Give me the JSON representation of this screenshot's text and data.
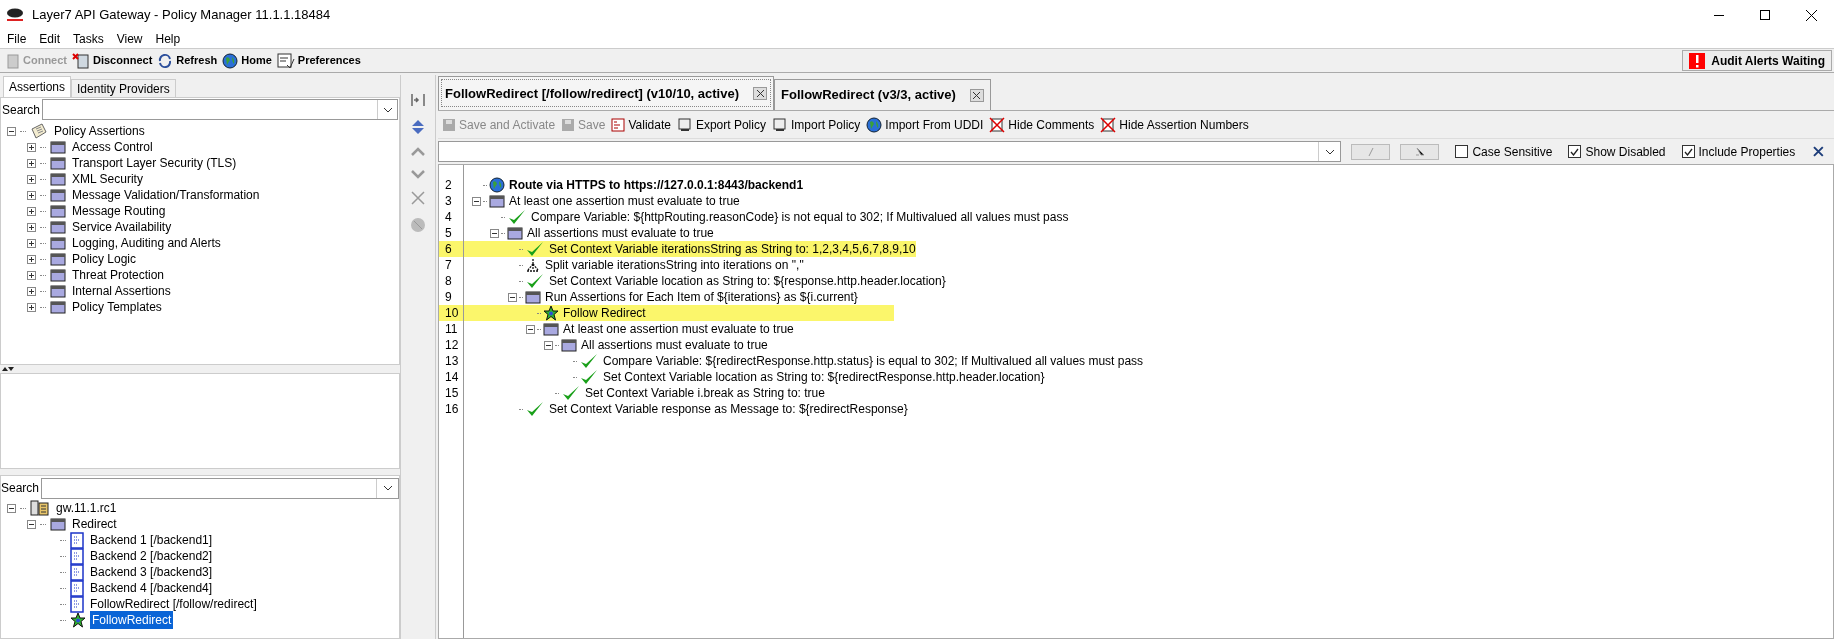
{
  "window": {
    "title": "Layer7 API Gateway - Policy Manager 11.1.1.18484"
  },
  "menu": [
    "File",
    "Edit",
    "Tasks",
    "View",
    "Help"
  ],
  "toolbar": [
    {
      "label": "Connect",
      "kind": "connect",
      "disabled": true
    },
    {
      "label": "Disconnect",
      "kind": "disconnect",
      "disabled": false
    },
    {
      "label": "Refresh",
      "kind": "refresh",
      "disabled": false
    },
    {
      "label": "Home",
      "kind": "home",
      "disabled": false
    },
    {
      "label": "Preferences",
      "kind": "preferences",
      "disabled": false
    }
  ],
  "audit_alert": "Audit Alerts Waiting",
  "left_tabs": [
    {
      "label": "Assertions",
      "selected": true
    },
    {
      "label": "Identity Providers",
      "selected": false
    }
  ],
  "assertions_search": {
    "label": "Search"
  },
  "assertions_tree": [
    {
      "label": "Policy Assertions",
      "kind": "root",
      "expanded": true,
      "children": [
        {
          "label": "Access Control",
          "kind": "folder",
          "expanded": false
        },
        {
          "label": "Transport Layer Security (TLS)",
          "kind": "folder",
          "expanded": false
        },
        {
          "label": "XML Security",
          "kind": "folder",
          "expanded": false
        },
        {
          "label": "Message Validation/Transformation",
          "kind": "folder",
          "expanded": false
        },
        {
          "label": "Message Routing",
          "kind": "folder",
          "expanded": false
        },
        {
          "label": "Service Availability",
          "kind": "folder",
          "expanded": false
        },
        {
          "label": "Logging, Auditing and Alerts",
          "kind": "folder",
          "expanded": false
        },
        {
          "label": "Policy Logic",
          "kind": "folder",
          "expanded": false
        },
        {
          "label": "Threat Protection",
          "kind": "folder",
          "expanded": false
        },
        {
          "label": "Internal Assertions",
          "kind": "folder",
          "expanded": false
        },
        {
          "label": "Policy Templates",
          "kind": "folder",
          "expanded": false
        }
      ]
    }
  ],
  "services_search": {
    "label": "Search"
  },
  "services_tree": [
    {
      "label": "gw.11.1.rc1",
      "kind": "gateway",
      "expanded": true,
      "selected": false,
      "children": [
        {
          "label": "Redirect",
          "kind": "folder",
          "expanded": true,
          "selected": false,
          "children": [
            {
              "label": "Backend 1 [/backend1]",
              "kind": "service",
              "selected": false
            },
            {
              "label": "Backend 2 [/backend2]",
              "kind": "service",
              "selected": false
            },
            {
              "label": "Backend 3 [/backend3]",
              "kind": "service",
              "selected": false
            },
            {
              "label": "Backend 4 [/backend4]",
              "kind": "service",
              "selected": false
            },
            {
              "label": "FollowRedirect [/follow/redirect]",
              "kind": "service",
              "selected": false
            },
            {
              "label": "FollowRedirect",
              "kind": "fragment",
              "selected": true
            }
          ]
        }
      ]
    }
  ],
  "editor_tabs": [
    {
      "label": "FollowRedirect [/follow/redirect] (v10/10, active)",
      "selected": true
    },
    {
      "label": "FollowRedirect (v3/3, active)",
      "selected": false
    }
  ],
  "editor_toolbar": [
    {
      "label": "Save and Activate",
      "kind": "save",
      "disabled": true
    },
    {
      "label": "Save",
      "kind": "save",
      "disabled": true
    },
    {
      "label": "Validate",
      "kind": "validate",
      "disabled": false
    },
    {
      "label": "Export Policy",
      "kind": "export",
      "disabled": false
    },
    {
      "label": "Import Policy",
      "kind": "import",
      "disabled": false
    },
    {
      "label": "Import From UDDI",
      "kind": "uddi",
      "disabled": false
    },
    {
      "label": "Hide Comments",
      "kind": "comments",
      "disabled": false
    },
    {
      "label": "Hide Assertion Numbers",
      "kind": "numbers",
      "disabled": false
    }
  ],
  "find_options": [
    {
      "label": "Case Sensitive",
      "checked": false
    },
    {
      "label": "Show Disabled",
      "checked": true
    },
    {
      "label": "Include Properties",
      "checked": true
    }
  ],
  "policy": [
    {
      "number": "2",
      "text": "Route via HTTPS to https://127.0.0.1:8443/backend1",
      "kind": "route",
      "bold": true,
      "highlighted": false
    },
    {
      "number": "3",
      "text": "At least one assertion must evaluate to true",
      "kind": "folder",
      "bold": false,
      "highlighted": false,
      "expanded": true,
      "children": [
        {
          "number": "4",
          "text": "Compare Variable: ${httpRouting.reasonCode} is not equal to 302; If Multivalued all values must pass",
          "kind": "check",
          "bold": false,
          "highlighted": false
        },
        {
          "number": "5",
          "text": "All assertions must evaluate to true",
          "kind": "folder",
          "bold": false,
          "highlighted": false,
          "expanded": true,
          "children": [
            {
              "number": "6",
              "text": "Set Context Variable iterationsString as String to: 1,2,3,4,5,6,7,8,9,10",
              "kind": "check",
              "bold": false,
              "highlighted": true
            },
            {
              "number": "7",
              "text": "Split variable iterationsString into iterations on \",\"",
              "kind": "split",
              "bold": false,
              "highlighted": false
            },
            {
              "number": "8",
              "text": "Set Context Variable location as String to: ${response.http.header.location}",
              "kind": "check",
              "bold": false,
              "highlighted": false
            },
            {
              "number": "9",
              "text": "Run Assertions for Each Item of ${iterations} as ${i.current}",
              "kind": "folder",
              "bold": false,
              "highlighted": false,
              "expanded": true,
              "children": [
                {
                  "number": "10",
                  "text": "Follow Redirect",
                  "kind": "redirect",
                  "bold": false,
                  "highlighted": true
                },
                {
                  "number": "11",
                  "text": "At least one assertion must evaluate to true",
                  "kind": "folder",
                  "bold": false,
                  "highlighted": false,
                  "expanded": true,
                  "children": [
                    {
                      "number": "12",
                      "text": "All assertions must evaluate to true",
                      "kind": "folder",
                      "bold": false,
                      "highlighted": false,
                      "expanded": true,
                      "children": [
                        {
                          "number": "13",
                          "text": "Compare Variable: ${redirectResponse.http.status} is equal to 302; If Multivalued all values must pass",
                          "kind": "check",
                          "bold": false,
                          "highlighted": false
                        },
                        {
                          "number": "14",
                          "text": "Set Context Variable location as String to: ${redirectResponse.http.header.location}",
                          "kind": "check",
                          "bold": false,
                          "highlighted": false
                        }
                      ]
                    },
                    {
                      "number": "15",
                      "text": "Set Context Variable i.break as String to: true",
                      "kind": "check",
                      "bold": false,
                      "highlighted": false
                    }
                  ]
                }
              ]
            },
            {
              "number": "16",
              "text": "Set Context Variable response as Message to: ${redirectResponse}",
              "kind": "check",
              "bold": false,
              "highlighted": false
            }
          ]
        }
      ]
    }
  ]
}
